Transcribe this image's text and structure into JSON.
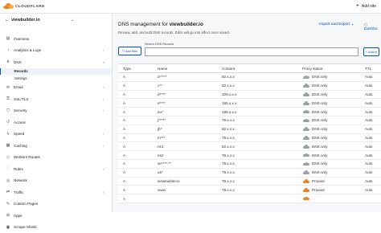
{
  "topbar": {
    "logo_text": "CLOUDFLARE",
    "add_site": "Add site"
  },
  "sidebar": {
    "site_name": "viewbuilder.io",
    "items": [
      {
        "label": "Overview",
        "icon": "document-icon"
      },
      {
        "label": "Analytics & Logs",
        "icon": "chart-icon"
      },
      {
        "label": "DNS",
        "icon": "network-icon"
      },
      {
        "label": "Email",
        "icon": "mail-icon"
      },
      {
        "label": "SSL/TLS",
        "icon": "lock-icon"
      },
      {
        "label": "Security",
        "icon": "shield-icon"
      },
      {
        "label": "Access",
        "icon": "access-icon"
      },
      {
        "label": "Speed",
        "icon": "lightning-icon"
      },
      {
        "label": "Caching",
        "icon": "caching-icon"
      },
      {
        "label": "Workers Routes",
        "icon": "workers-icon"
      },
      {
        "label": "Rules",
        "icon": "rules-icon"
      },
      {
        "label": "Network",
        "icon": "globe-icon"
      },
      {
        "label": "Traffic",
        "icon": "traffic-icon"
      },
      {
        "label": "Custom Pages",
        "icon": "wrench-icon"
      },
      {
        "label": "Apps",
        "icon": "apps-icon"
      },
      {
        "label": "Scrape Shield",
        "icon": "scrape-shield-icon"
      }
    ],
    "dns_sub": [
      "Records",
      "Settings"
    ]
  },
  "main": {
    "title_prefix": "DNS management for ",
    "title_domain": "viewbuilder.io",
    "subtitle": "Review, add, and edit DNS records. Edits will go into effect once saved.",
    "import_export": "Import and Export",
    "dashboard": "Dashbo",
    "add_filter": "Add filter",
    "search_label": "Search DNS Records",
    "search_value": "",
    "add_record": "Add re"
  },
  "table": {
    "headers": [
      "Type",
      "Name",
      "Content",
      "Proxy status",
      "TTL"
    ],
    "rows": [
      {
        "type": "A",
        "name": "a*****",
        "content": "82.x.x.x",
        "proxy": "DNS only",
        "orange": false,
        "ttl": "Auto"
      },
      {
        "type": "A",
        "name": "c**",
        "content": "82.x.x.x",
        "proxy": "DNS only",
        "orange": false,
        "ttl": "Auto"
      },
      {
        "type": "A",
        "name": "d****",
        "content": "109.x.x.x",
        "proxy": "DNS only",
        "orange": false,
        "ttl": "Auto"
      },
      {
        "type": "A",
        "name": "e****",
        "content": "185.x.x.x",
        "proxy": "DNS only",
        "orange": false,
        "ttl": "Auto"
      },
      {
        "type": "A",
        "name": "eu*",
        "content": "185.x.x.x",
        "proxy": "DNS only",
        "orange": false,
        "ttl": "Auto"
      },
      {
        "type": "A",
        "name": "j*****",
        "content": "79.x.x.x",
        "proxy": "DNS only",
        "orange": false,
        "ttl": "Auto"
      },
      {
        "type": "A",
        "name": "jb*",
        "content": "82.x.x.x",
        "proxy": "DNS only",
        "orange": false,
        "ttl": "Auto"
      },
      {
        "type": "A",
        "name": "m***",
        "content": "79.x.x.x",
        "proxy": "DNS only",
        "orange": false,
        "ttl": "Auto"
      },
      {
        "type": "A",
        "name": "ns1",
        "content": "82.x.x.x",
        "proxy": "DNS only",
        "orange": false,
        "ttl": "Auto"
      },
      {
        "type": "A",
        "name": "ns2",
        "content": "79.x.x.x",
        "proxy": "DNS only",
        "orange": false,
        "ttl": "Auto"
      },
      {
        "type": "A",
        "name": "se****.**",
        "content": "79.x.x.x",
        "proxy": "DNS only",
        "orange": false,
        "ttl": "Auto"
      },
      {
        "type": "A",
        "name": "us*",
        "content": "79.x.x.x",
        "proxy": "DNS only",
        "orange": false,
        "ttl": "Auto"
      },
      {
        "type": "A",
        "name": "viewbuilder.io",
        "content": "79.x.x.x",
        "proxy": "Proxied",
        "orange": true,
        "ttl": "Auto"
      },
      {
        "type": "A",
        "name": "www",
        "content": "79.x.x.x",
        "proxy": "Proxied",
        "orange": true,
        "ttl": "Auto"
      },
      {
        "type": "A",
        "name": "",
        "content": "",
        "proxy": "",
        "orange": true,
        "ttl": ""
      }
    ]
  },
  "colors": {
    "accent": "#0051c3",
    "orange": "#f38020",
    "grey_cloud": "#9aa0a6"
  }
}
